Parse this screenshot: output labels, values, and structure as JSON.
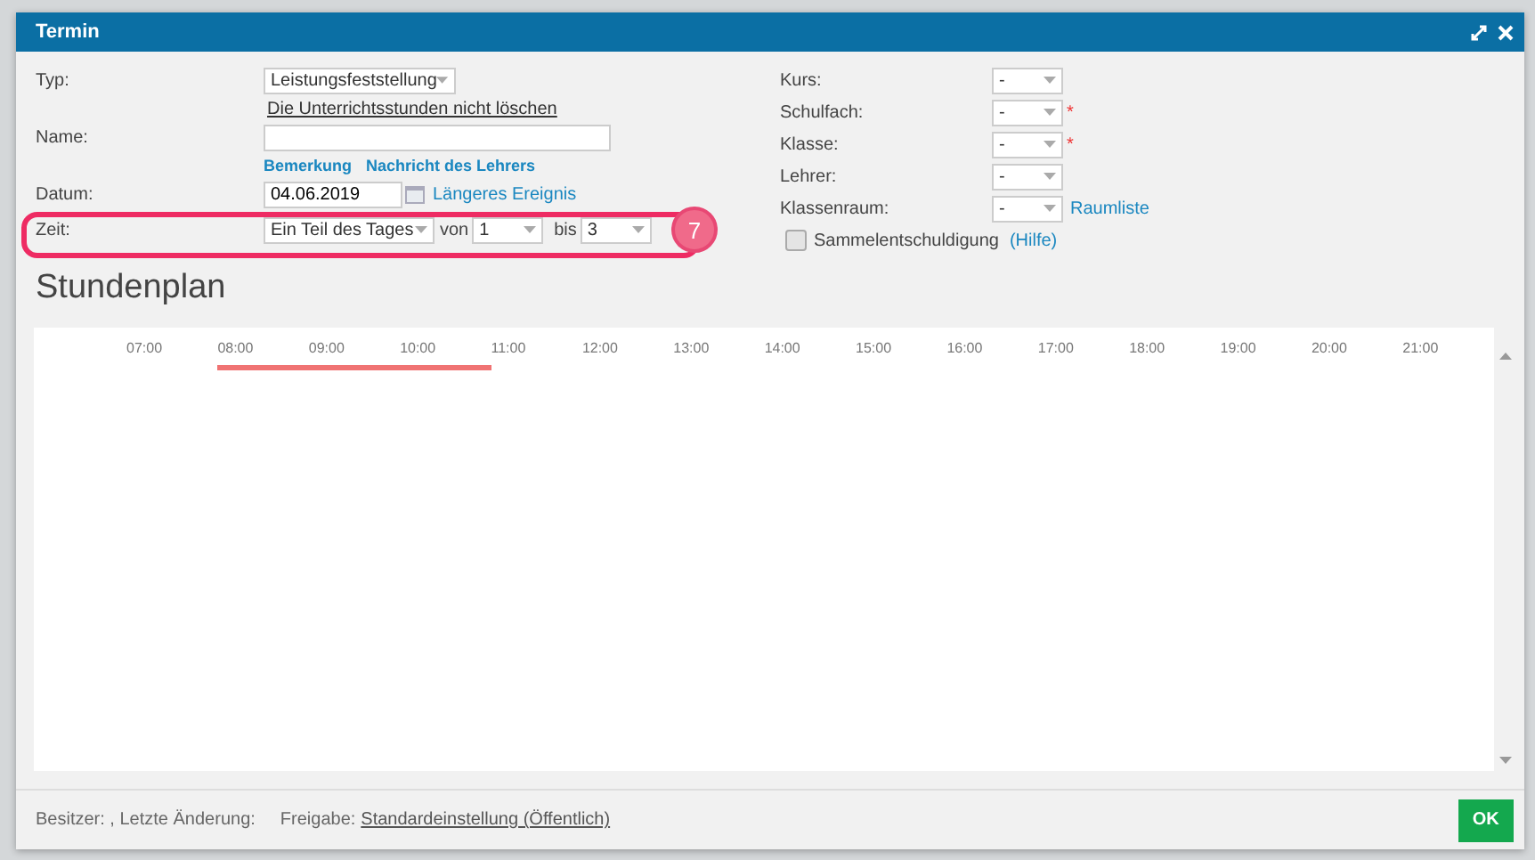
{
  "window": {
    "title": "Termin"
  },
  "form_left": {
    "typ": {
      "label": "Typ:",
      "value": "Leistungsfeststellung"
    },
    "keep_lessons_link": "Die Unterrichtsstunden nicht löschen",
    "name": {
      "label": "Name:"
    },
    "name_links": [
      "Bemerkung",
      "Nachricht des Lehrers"
    ],
    "datum": {
      "label": "Datum:",
      "value": "04.06.2019",
      "link": "Längeres Ereignis"
    },
    "zeit": {
      "label": "Zeit:",
      "mode": "Ein Teil des Tages",
      "from_label": "von",
      "from": "1",
      "to_label": "bis",
      "to": "3",
      "callout": "7"
    }
  },
  "form_right": [
    {
      "label": "Kurs:",
      "value": "-"
    },
    {
      "label": "Schulfach:",
      "value": "-",
      "required_mark": "*"
    },
    {
      "label": "Klasse:",
      "value": "-",
      "required_mark": "*"
    },
    {
      "label": "Lehrer:",
      "value": "-"
    },
    {
      "label": "Klassenraum:",
      "value": "-",
      "link": "Raumliste"
    }
  ],
  "collective_excuse": {
    "label": "Sammelentschuldigung",
    "checked": false,
    "help": "(Hilfe)"
  },
  "timetable": {
    "title": "Stundenplan",
    "hours": [
      {
        "label": "07:00",
        "highlighted": false
      },
      {
        "label": "08:00",
        "highlighted": true
      },
      {
        "label": "09:00",
        "highlighted": true
      },
      {
        "label": "10:00",
        "highlighted": true
      },
      {
        "label": "11:00",
        "highlighted": false
      },
      {
        "label": "12:00",
        "highlighted": false
      },
      {
        "label": "13:00",
        "highlighted": false
      },
      {
        "label": "14:00",
        "highlighted": false
      },
      {
        "label": "15:00",
        "highlighted": false
      },
      {
        "label": "16:00",
        "highlighted": false
      },
      {
        "label": "17:00",
        "highlighted": false
      },
      {
        "label": "18:00",
        "highlighted": false
      },
      {
        "label": "19:00",
        "highlighted": false
      },
      {
        "label": "20:00",
        "highlighted": false
      },
      {
        "label": "21:00",
        "highlighted": false
      }
    ]
  },
  "footer": {
    "owner": "Besitzer: , Letzte Änderung:",
    "share_label": "Freigabe:",
    "share_link": "Standardeinstellung (Öffentlich)",
    "ok": "OK"
  }
}
